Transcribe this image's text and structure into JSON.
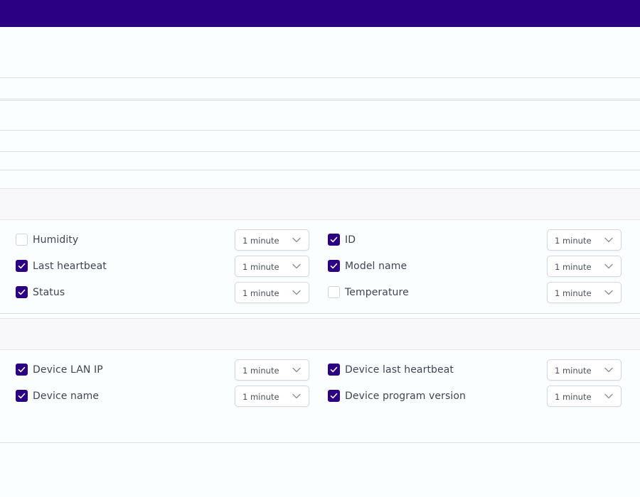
{
  "colors": {
    "brand": "#2b0083",
    "text": "#3f4452",
    "border": "#d3d7de"
  },
  "section1": {
    "fields": [
      {
        "label": "Humidity",
        "checked": false,
        "interval": "1 minute"
      },
      {
        "label": "ID",
        "checked": true,
        "interval": "1 minute"
      },
      {
        "label": "Last heartbeat",
        "checked": true,
        "interval": "1 minute"
      },
      {
        "label": "Model name",
        "checked": true,
        "interval": "1 minute"
      },
      {
        "label": "Status",
        "checked": true,
        "interval": "1 minute"
      },
      {
        "label": "Temperature",
        "checked": false,
        "interval": "1 minute"
      }
    ]
  },
  "section2": {
    "fields": [
      {
        "label": "Device LAN IP",
        "checked": true,
        "interval": "1 minute"
      },
      {
        "label": "Device last heartbeat",
        "checked": true,
        "interval": "1 minute"
      },
      {
        "label": "Device name",
        "checked": true,
        "interval": "1 minute"
      },
      {
        "label": "Device program version",
        "checked": true,
        "interval": "1 minute"
      }
    ]
  },
  "icons": {
    "checkbox_tick": "check-icon",
    "select_arrow": "chevron-down-icon"
  }
}
